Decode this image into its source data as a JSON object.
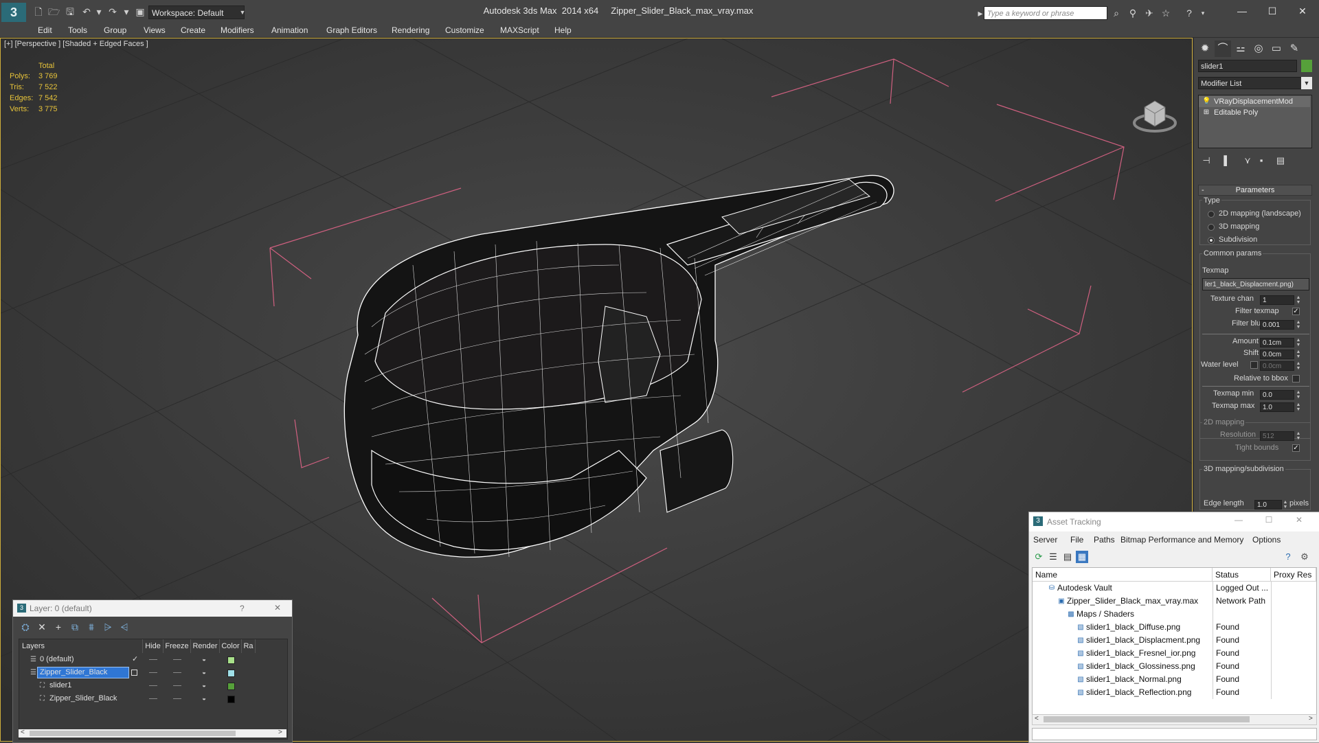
{
  "app": {
    "title": "Autodesk 3ds Max  2014 x64     Zipper_Slider_Black_max_vray.max",
    "logo": "3ds-max-logo",
    "workspace": "Workspace: Default",
    "search_placeholder": "Type a keyword or phrase"
  },
  "menu": [
    "Edit",
    "Tools",
    "Group",
    "Views",
    "Create",
    "Modifiers",
    "Animation",
    "Graph Editors",
    "Rendering",
    "Customize",
    "MAXScript",
    "Help"
  ],
  "viewport": {
    "label": "[+] [Perspective ] [Shaded + Edged Faces ]",
    "stats": {
      "header": "Total",
      "rows": [
        {
          "label": "Polys:",
          "value": "3 769"
        },
        {
          "label": "Tris:",
          "value": "7 522"
        },
        {
          "label": "Edges:",
          "value": "7 542"
        },
        {
          "label": "Verts:",
          "value": "3 775"
        }
      ]
    }
  },
  "command_panel": {
    "object_name": "slider1",
    "object_color": "#56a03a",
    "modifier_list": "Modifier List",
    "stack": [
      {
        "icon": "lightbulb-icon",
        "label": "VRayDisplacementMod"
      },
      {
        "icon": "plus-icon",
        "label": "Editable Poly"
      }
    ],
    "parameters": {
      "rollout_title": "Parameters",
      "type_label": "Type",
      "type_options": [
        "2D mapping (landscape)",
        "3D mapping",
        "Subdivision"
      ],
      "type_selected": 2,
      "common_params_label": "Common params",
      "texmap_label": "Texmap",
      "texmap_value": "ler1_black_Displacment.png)",
      "texture_chan_label": "Texture chan",
      "texture_chan": "1",
      "filter_texmap_label": "Filter texmap",
      "filter_blur_label": "Filter blur",
      "filter_blur": "0.001",
      "amount_label": "Amount",
      "amount": "0.1cm",
      "shift_label": "Shift",
      "shift": "0.0cm",
      "water_level_label": "Water level",
      "water_level": "0.0cm",
      "relative_label": "Relative to bbox",
      "texmap_min_label": "Texmap min",
      "texmap_min": "0.0",
      "texmap_max_label": "Texmap max",
      "texmap_max": "1.0",
      "mapping2d_label": "2D mapping",
      "resolution_label": "Resolution",
      "resolution": "512",
      "tight_bounds_label": "Tight bounds",
      "mapping3d_label": "3D mapping/subdivision",
      "edge_length_label": "Edge length",
      "edge_length": "1.0",
      "edge_length_unit": "pixels"
    }
  },
  "asset_tracking": {
    "title": "Asset Tracking",
    "menu": [
      "Server",
      "File",
      "Paths",
      "Bitmap Performance and Memory",
      "Options"
    ],
    "columns": [
      "Name",
      "Status",
      "Proxy Res"
    ],
    "rows": [
      {
        "name": "Autodesk Vault",
        "status": "Logged Out ...",
        "indent": 1,
        "icon": "vault-icon"
      },
      {
        "name": "Zipper_Slider_Black_max_vray.max",
        "status": "Network Path",
        "indent": 2,
        "icon": "max-file-icon"
      },
      {
        "name": "Maps / Shaders",
        "status": "",
        "indent": 3,
        "icon": "maps-icon"
      },
      {
        "name": "slider1_black_Diffuse.png",
        "status": "Found",
        "indent": 4,
        "icon": "bitmap-icon"
      },
      {
        "name": "slider1_black_Displacment.png",
        "status": "Found",
        "indent": 4,
        "icon": "bitmap-icon"
      },
      {
        "name": "slider1_black_Fresnel_ior.png",
        "status": "Found",
        "indent": 4,
        "icon": "bitmap-icon"
      },
      {
        "name": "slider1_black_Glossiness.png",
        "status": "Found",
        "indent": 4,
        "icon": "bitmap-icon"
      },
      {
        "name": "slider1_black_Normal.png",
        "status": "Found",
        "indent": 4,
        "icon": "bitmap-icon"
      },
      {
        "name": "slider1_black_Reflection.png",
        "status": "Found",
        "indent": 4,
        "icon": "bitmap-icon"
      }
    ]
  },
  "layer_dialog": {
    "title": "Layer: 0 (default)",
    "help": "?",
    "columns": [
      "Layers",
      "Hide",
      "Freeze",
      "Render",
      "Color",
      "Ra"
    ],
    "rows": [
      {
        "name": "0 (default)",
        "indent": 1,
        "current": true,
        "selected": false,
        "color": "#a8e08a"
      },
      {
        "name": "Zipper_Slider_Black",
        "indent": 1,
        "current": false,
        "selected": true,
        "color": "#a0e0e8"
      },
      {
        "name": "slider1",
        "indent": 2,
        "current": false,
        "selected": false,
        "color": "#56a03a"
      },
      {
        "name": "Zipper_Slider_Black",
        "indent": 2,
        "current": false,
        "selected": false,
        "color": "#000000"
      }
    ]
  }
}
